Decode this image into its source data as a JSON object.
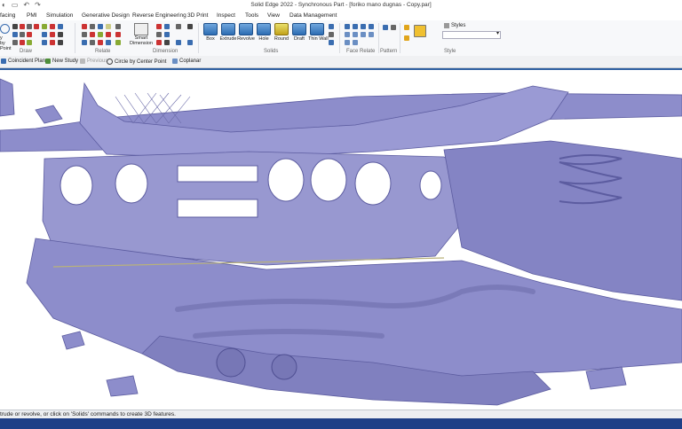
{
  "window": {
    "title": "Solid Edge 2022 - Synchronous Part - [foriko mano dugnas - Copy.par]"
  },
  "menu": [
    "facing",
    "PMI",
    "Simulation",
    "Generative Design",
    "Reverse Engineering",
    "3D Print",
    "Inspect",
    "Tools",
    "View",
    "Data Management"
  ],
  "ribbon": {
    "left_cut_label": "y by",
    "left_cut_label2": "Point",
    "groups": {
      "draw": "Draw",
      "relate": "Relate",
      "dimension": "Dimension",
      "solids": "Solids",
      "face_relate": "Face Relate",
      "pattern": "Pattern",
      "style": "Style"
    },
    "smart_dimension": [
      "Smart",
      "Dimension"
    ],
    "solids_buttons": [
      "Box",
      "Extrude",
      "Revolve",
      "Hole",
      "Round",
      "Draft",
      "Thin Wall"
    ],
    "styles_label": "Styles"
  },
  "commandbar": {
    "coincident_plane": "Coincident Plane",
    "new_study": "New Study",
    "previous": "Previous",
    "circle_center": "Circle by Center Point",
    "coplanar": "Coplanar"
  },
  "status": {
    "prompt": "trude or revolve, or click on 'Solids' commands to create 3D features."
  },
  "colors": {
    "mesh": "#8d8dcb",
    "mesh_dark": "#5c5ca0",
    "accent": "#2f5fa0",
    "taskbar": "#1e3f87"
  }
}
